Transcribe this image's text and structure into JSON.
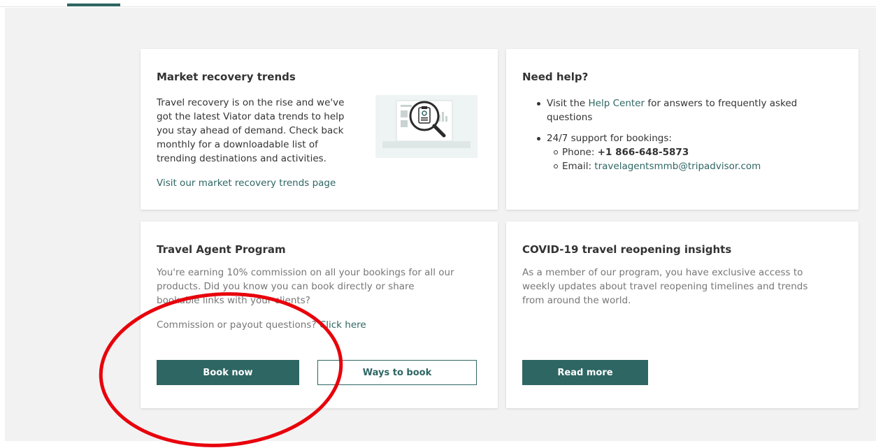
{
  "cards": {
    "market": {
      "title": "Market recovery trends",
      "body_lines": [
        "Travel recovery is on the rise and we've",
        "got the latest Viator data trends to help",
        "you stay ahead of demand. Check back",
        "monthly for a downloadable list of",
        "trending destinations and activities."
      ],
      "link": "Visit our market recovery trends page",
      "illustration_icon": "magnifier-document-illustration"
    },
    "help": {
      "title": "Need help?",
      "item1_prefix": "Visit the ",
      "item1_link": "Help Center",
      "item1_suffix": " for answers to frequently asked questions",
      "item2": "24/7 support for bookings:",
      "phone_label": "Phone: ",
      "phone": "+1 866-648-5873",
      "email_label": "Email: ",
      "email": "travelagentsmmb@tripadvisor.com"
    },
    "agent": {
      "title": "Travel Agent Program",
      "body_lines": [
        "You're earning 10% commission on all your bookings for all our",
        "products. Did you know you can book directly or share",
        "bookable links with your clients?"
      ],
      "commission_text": "Commission or payout questions? ",
      "commission_link": "Click here",
      "book_now": "Book now",
      "ways_to_book": "Ways to book"
    },
    "covid": {
      "title": "COVID-19 travel reopening insights",
      "body_lines": [
        "As a member of our program, you have exclusive access to",
        "weekly updates about travel reopening timelines and trends",
        "from around the world."
      ],
      "read_more": "Read more"
    }
  },
  "colors": {
    "accent": "#2e6663",
    "annotation": "#e8000b",
    "background": "#f2f2f2"
  }
}
